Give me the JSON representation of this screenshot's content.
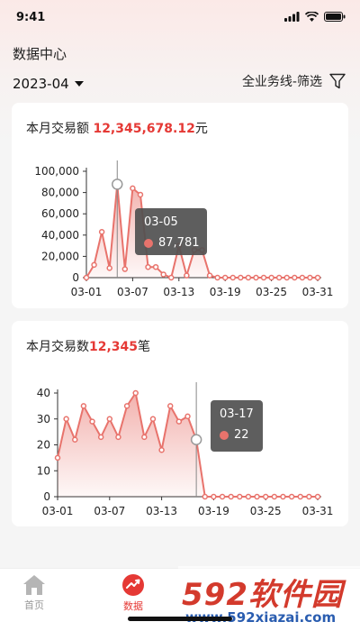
{
  "status_bar": {
    "time": "9:41"
  },
  "header": {
    "title": "数据中心",
    "month": "2023-04",
    "filter_label": "全业务线-筛选"
  },
  "cards": [
    {
      "title_prefix": "本月交易额 ",
      "title_value": "12,345,678.12",
      "title_suffix": "元",
      "tooltip": {
        "date": "03-05",
        "value": "87,781"
      }
    },
    {
      "title_prefix": "本月交易数",
      "title_value": "12,345",
      "title_suffix": "笔",
      "tooltip": {
        "date": "03-17",
        "value": "22"
      }
    }
  ],
  "chart_data": [
    {
      "type": "area",
      "x": [
        "03-01",
        "03-02",
        "03-03",
        "03-04",
        "03-05",
        "03-06",
        "03-07",
        "03-08",
        "03-09",
        "03-10",
        "03-11",
        "03-12",
        "03-13",
        "03-14",
        "03-15",
        "03-16",
        "03-17",
        "03-18",
        "03-19",
        "03-20",
        "03-21",
        "03-22",
        "03-23",
        "03-24",
        "03-25",
        "03-26",
        "03-27",
        "03-28",
        "03-29",
        "03-30",
        "03-31"
      ],
      "values": [
        0,
        12000,
        43000,
        9000,
        87781,
        8000,
        84000,
        78000,
        10000,
        10000,
        3000,
        0,
        30000,
        2000,
        26000,
        26000,
        2000,
        0,
        0,
        0,
        0,
        0,
        0,
        0,
        0,
        0,
        0,
        0,
        0,
        0,
        0
      ],
      "x_ticks": [
        "03-01",
        "03-07",
        "03-13",
        "03-19",
        "03-25",
        "03-31"
      ],
      "y_ticks": [
        "0",
        "20,000",
        "40,000",
        "60,000",
        "80,000",
        "100,000"
      ],
      "ylim": [
        0,
        100000
      ],
      "highlight_index": 4,
      "color": "#e8736c"
    },
    {
      "type": "area",
      "x": [
        "03-01",
        "03-02",
        "03-03",
        "03-04",
        "03-05",
        "03-06",
        "03-07",
        "03-08",
        "03-09",
        "03-10",
        "03-11",
        "03-12",
        "03-13",
        "03-14",
        "03-15",
        "03-16",
        "03-17",
        "03-18",
        "03-19",
        "03-20",
        "03-21",
        "03-22",
        "03-23",
        "03-24",
        "03-25",
        "03-26",
        "03-27",
        "03-28",
        "03-29",
        "03-30",
        "03-31"
      ],
      "values": [
        15,
        30,
        22,
        35,
        29,
        23,
        30,
        23,
        35,
        40,
        23,
        30,
        18,
        35,
        29,
        31,
        22,
        0,
        0,
        0,
        0,
        0,
        0,
        0,
        0,
        0,
        0,
        0,
        0,
        0,
        0
      ],
      "x_ticks": [
        "03-01",
        "03-07",
        "03-13",
        "03-19",
        "03-25",
        "03-31"
      ],
      "y_ticks": [
        "0",
        "10",
        "20",
        "30",
        "40"
      ],
      "ylim": [
        0,
        40
      ],
      "highlight_index": 16,
      "color": "#e8736c"
    }
  ],
  "tabbar": {
    "home_label": "首页",
    "data_label": "数据"
  },
  "watermark": {
    "logo": "592软件园",
    "url": "www.592xiazai.com"
  },
  "colors": {
    "accent": "#e53935",
    "line": "#e8736c",
    "tooltip_bg": "#505050"
  }
}
